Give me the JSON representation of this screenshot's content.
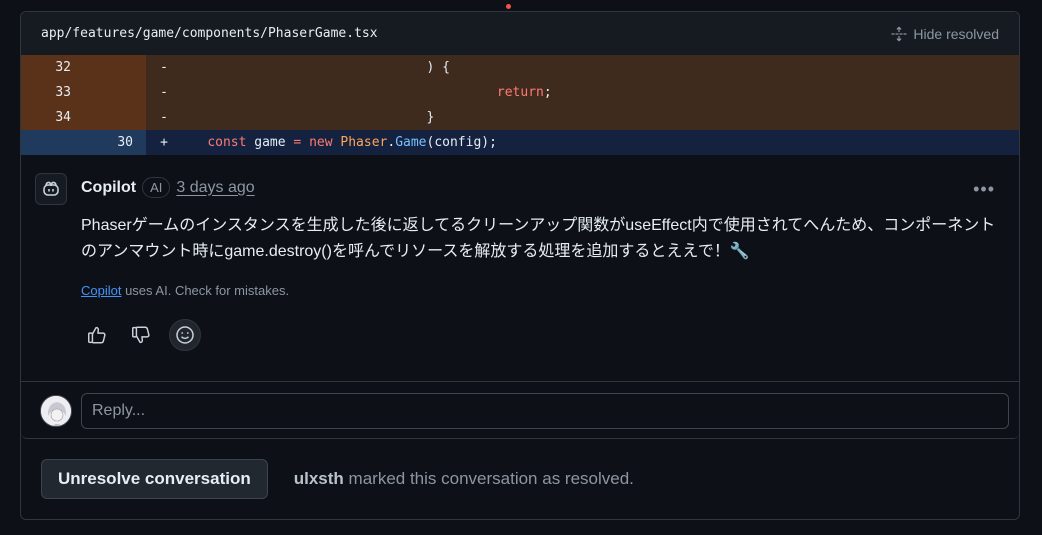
{
  "file": {
    "path": "app/features/game/components/PhaserGame.tsx",
    "hide_resolved_label": "Hide resolved"
  },
  "diff": {
    "deleted_lines": [
      {
        "old": "32",
        "marker": "-",
        "code": "                                ) {"
      },
      {
        "old": "33",
        "marker": "-",
        "code": "                                         "
      },
      {
        "old": "34",
        "marker": "-",
        "code": "                                }"
      }
    ],
    "deleted_return_keyword": "return",
    "deleted_return_suffix": ";",
    "added_line": {
      "new": "30",
      "marker": "+",
      "indent": "    ",
      "kw_const": "const",
      "ident": " game ",
      "op": "=",
      "kw_new": " new ",
      "class_name": "Phaser",
      "dot": ".",
      "method": "Game",
      "args": "(config);"
    }
  },
  "comment": {
    "author": "Copilot",
    "badge": "AI",
    "timestamp": "3 days ago",
    "more_label": "•••",
    "body": "Phaserゲームのインスタンスを生成した後に返してるクリーンアップ関数がuseEffect内で使用されてへんため、コンポーネントのアンマウント時にgame.destroy()を呼んでリソースを解放する処理を追加するとええで！🔧",
    "disclaimer_link": "Copilot",
    "disclaimer_text": " uses AI. Check for mistakes.",
    "reactions": [
      "thumbs-up-icon",
      "thumbs-down-icon",
      "smiley-icon"
    ]
  },
  "reply": {
    "placeholder": "Reply..."
  },
  "resolution": {
    "button_label": "Unresolve conversation",
    "user": "ulxsth",
    "message": " marked this conversation as resolved."
  },
  "colors": {
    "background": "#0d1117",
    "deleted_row": "#3f2a1e",
    "added_row": "#142240",
    "link": "#4493f8",
    "keyword": "#ff7b72",
    "class": "#ffa657"
  }
}
